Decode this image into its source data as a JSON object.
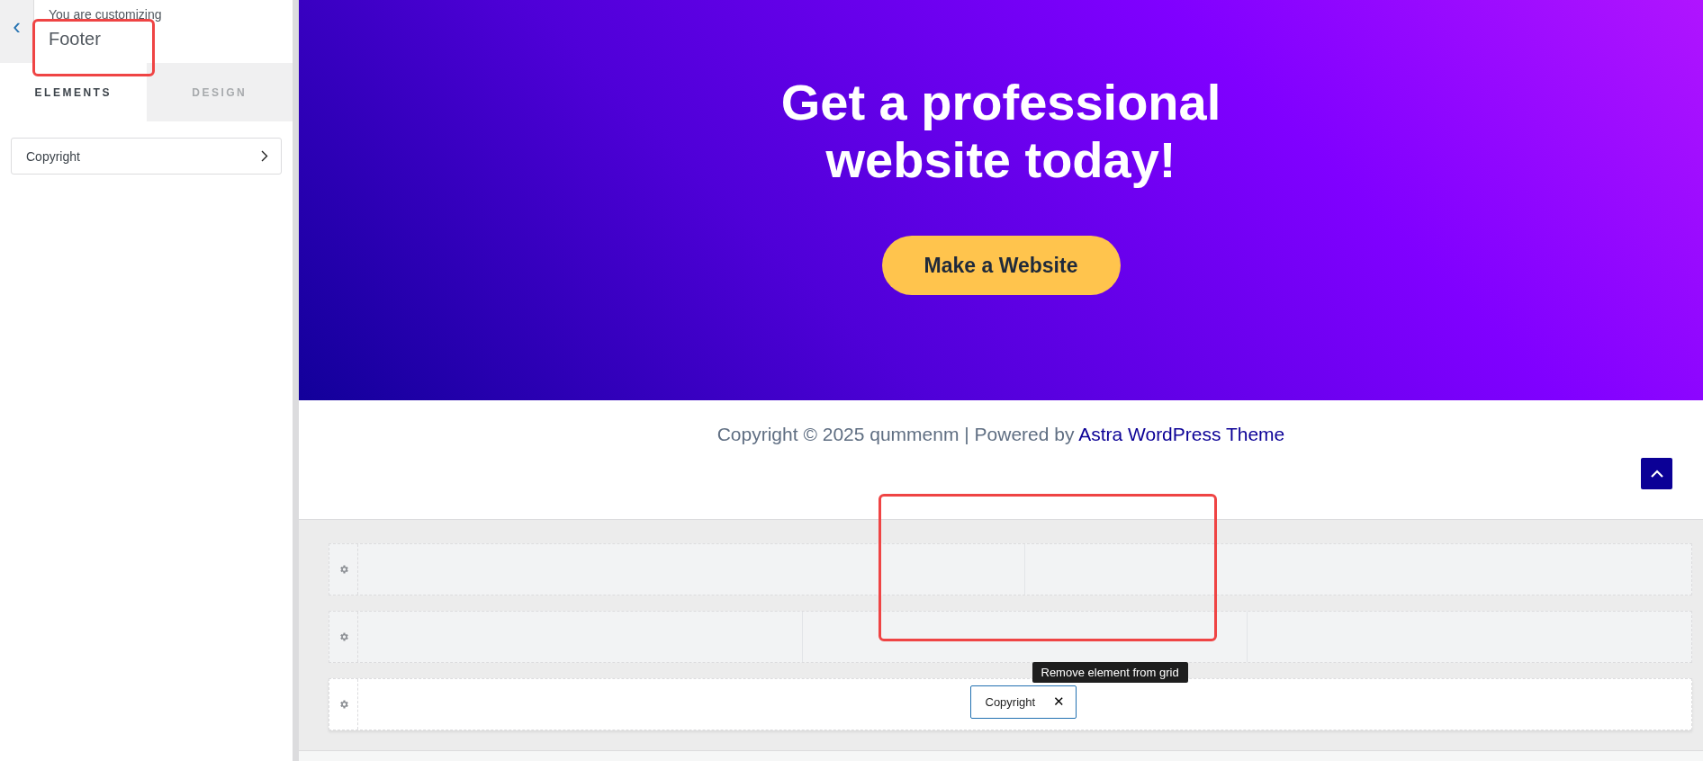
{
  "sidebar": {
    "back_label": "‹",
    "eyebrow": "You are customizing",
    "title": "Footer",
    "tabs": [
      {
        "label": "ELEMENTS",
        "selected": true
      },
      {
        "label": "DESIGN",
        "selected": false
      }
    ],
    "items": [
      {
        "label": "Copyright"
      }
    ]
  },
  "hero": {
    "heading": "Get a professional website today!",
    "button": "Make a Website"
  },
  "footer": {
    "text": "Copyright © 2025 qummenm | Powered by ",
    "link": "Astra WordPress Theme"
  },
  "builder": {
    "rows": [
      {
        "kind": "halves",
        "active": false
      },
      {
        "kind": "thirds",
        "active": false
      },
      {
        "kind": "single",
        "active": true,
        "element": "Copyright",
        "remove_label": "✕",
        "tooltip": "Remove element from grid"
      }
    ]
  }
}
